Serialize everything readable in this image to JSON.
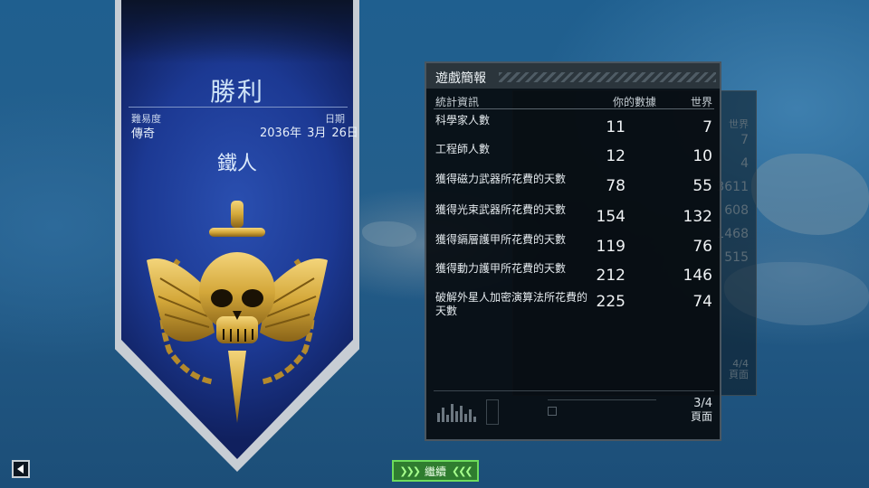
{
  "banner": {
    "title": "勝利",
    "difficulty_label": "難易度",
    "difficulty_value": "傳奇",
    "date_label": "日期",
    "date_year": "2036年",
    "date_month": "3月",
    "date_day": "26日",
    "subtitle": "鐵人",
    "emblem_icon": "winged-skull-dagger-emblem-icon"
  },
  "report": {
    "title": "遊戲簡報",
    "col_stat": "統計資訊",
    "col_mine": "你的數據",
    "col_world": "世界",
    "rows": [
      {
        "label": "科學家人數",
        "mine": "11",
        "world": "7"
      },
      {
        "label": "工程師人數",
        "mine": "12",
        "world": "10"
      },
      {
        "label": "獲得磁力武器所花費的天數",
        "mine": "78",
        "world": "55"
      },
      {
        "label": "獲得光束武器所花費的天數",
        "mine": "154",
        "world": "132"
      },
      {
        "label": "獲得鎘層護甲所花費的天數",
        "mine": "119",
        "world": "76"
      },
      {
        "label": "獲得動力護甲所花費的天數",
        "mine": "212",
        "world": "146"
      },
      {
        "label": "破解外星人加密演算法所花費的天數",
        "mine": "225",
        "world": "74"
      }
    ],
    "page_number": "3/4",
    "page_label": "頁面"
  },
  "back_panel": {
    "col_world": "世界",
    "values": [
      "7",
      "4",
      "3611",
      "608",
      "1468",
      "515"
    ],
    "page_number": "4/4",
    "page_label": "頁面"
  },
  "controls": {
    "continue_label": "繼續",
    "back_icon": "back-arrow-icon"
  },
  "colors": {
    "continue_green": "#2f7d2f",
    "banner_blue": "#1c3993",
    "emblem_gold": "#d4a83a"
  }
}
